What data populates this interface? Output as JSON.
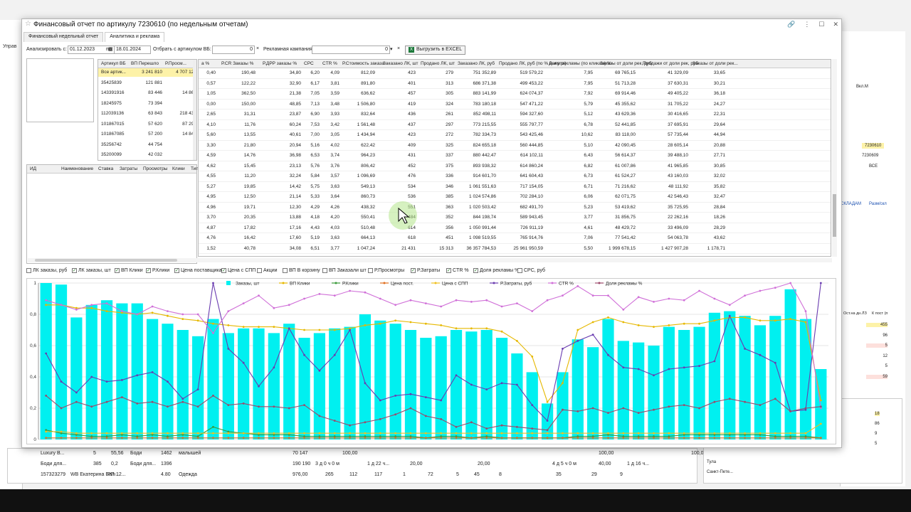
{
  "window": {
    "title": "Финансовый отчет по артикулу 7230610 (по недельным отчетам)",
    "tabs": [
      "Финансовый недельный отчет",
      "Аналитика и реклама"
    ],
    "active_tab": 1
  },
  "filters": {
    "analyze_from_label": "Анализировать с:",
    "date_from": "01.12.2023",
    "to_label": "по:",
    "date_to": "18.01.2024",
    "filter_label": "Отбрать с артикулом ВБ:",
    "filter_value": "0",
    "campaign_label": "Рекламная кампания:",
    "campaign_value": "0",
    "excel_label": "Выгрузить в EXCEL"
  },
  "background": {
    "left_label": "Управ",
    "bottom_rows": [
      [
        "Luxury B...",
        "5",
        "55,56",
        "Боди",
        "1462",
        "малышей",
        "70 147",
        "100,00",
        "100,00",
        "100,00"
      ],
      [
        "Боди для...",
        "385",
        "0,2",
        "Боди для...",
        "1396",
        "",
        "190 190",
        "3 д 0 ч 0 м",
        "1 д 22 ч...",
        "20,00",
        "20,00",
        "4 д 5 ч 0 м",
        "40,00",
        "1 д 16 ч..."
      ],
      [
        "157323279",
        "WB Екатерина Бал...",
        "РП-12...",
        "4.80",
        "Одежда",
        "976,00",
        "265",
        "112",
        "117",
        "1",
        "72",
        "5",
        "45",
        "8",
        "35",
        "29",
        "9"
      ]
    ],
    "right_items": [
      "7230610",
      "7230609",
      "ВСЕ",
      "Вкл.М",
      "СКЛАДАМ",
      "Разм/скл"
    ],
    "right_cols": [
      "Ост.на дн.ЛЗ",
      "К пост (п"
    ],
    "right_vals": [
      "455",
      "96",
      "5",
      "12",
      "5",
      "59",
      "18",
      "86",
      "9",
      "5"
    ],
    "right_city": [
      "Тула",
      "Санкт-Пете..."
    ]
  },
  "sku_table": {
    "headers": [
      "Артикул ВБ",
      "ВП Перешло",
      "Р.Просм..."
    ],
    "rows": [
      [
        "Все артик...",
        "3 241 810",
        "4 707 122"
      ],
      [
        "35425839",
        "121 881",
        ""
      ],
      [
        "143391916",
        "83 446",
        "14 862"
      ],
      [
        "18245975",
        "73 394",
        ""
      ],
      [
        "112039136",
        "63 843",
        "218 437"
      ],
      [
        "101867015",
        "57 620",
        "87 295"
      ],
      [
        "101867085",
        "57 200",
        "14 841"
      ],
      [
        "35256742",
        "44 754",
        ""
      ],
      [
        "35200099",
        "42 032",
        ""
      ]
    ]
  },
  "id_table": {
    "headers": [
      "ИД",
      "Наименование",
      "Ставка",
      "Затраты",
      "Просмотры",
      "Клики",
      "Тип"
    ]
  },
  "main_table": {
    "headers": [
      "а %",
      "Р.CR Заказы %",
      "Р.ДРР заказы %",
      "CPC",
      "CTR %",
      "Р.Стоимость заказа",
      "Заказано ЛК, шт",
      "Продано ЛК, шт",
      "Заказано ЛК, руб",
      "Продано ЛК, руб (по % выкупа)",
      "Доля рекламы (по кликам) %",
      "Заказы от доли рек, руб",
      "Продажи от доли рек, руб",
      "Заказы от доли рек..."
    ],
    "rows": [
      [
        "0,40",
        "190,48",
        "34,80",
        "6,20",
        "4,09",
        "812,09",
        "423",
        "279",
        "751 352,89",
        "519 579,22",
        "7,95",
        "69 765,15",
        "41 329,09",
        "33,65"
      ],
      [
        "0,57",
        "122,22",
        "32,90",
        "6,17",
        "3,81",
        "891,80",
        "401",
        "313",
        "686 371,38",
        "499 453,22",
        "7,95",
        "51 713,28",
        "37 630,31",
        "30,21"
      ],
      [
        "1,05",
        "362,50",
        "21,38",
        "7,05",
        "3,59",
        "636,62",
        "457",
        "305",
        "883 141,99",
        "624 074,37",
        "7,92",
        "69 914,46",
        "49 405,22",
        "36,18"
      ],
      [
        "0,00",
        "150,00",
        "48,85",
        "7,13",
        "3,48",
        "1 506,80",
        "419",
        "324",
        "783 180,18",
        "547 471,22",
        "5,79",
        "45 355,62",
        "31 705,22",
        "24,27"
      ],
      [
        "2,65",
        "31,31",
        "23,87",
        "6,90",
        "3,93",
        "832,64",
        "436",
        "261",
        "852 498,11",
        "594 327,60",
        "5,12",
        "43 629,36",
        "30 416,65",
        "22,31"
      ],
      [
        "4,10",
        "11,76",
        "60,24",
        "7,53",
        "3,42",
        "1 561,48",
        "437",
        "297",
        "773 215,55",
        "555 797,77",
        "6,78",
        "52 441,85",
        "37 695,91",
        "29,64"
      ],
      [
        "5,60",
        "13,55",
        "40,61",
        "7,00",
        "3,05",
        "1 434,94",
        "423",
        "272",
        "782 334,73",
        "543 425,46",
        "10,62",
        "83 118,00",
        "57 735,44",
        "44,94"
      ],
      [
        "3,30",
        "21,80",
        "20,94",
        "5,16",
        "4,02",
        "622,42",
        "409",
        "325",
        "824 655,18",
        "560 444,85",
        "5,10",
        "42 090,45",
        "28 605,14",
        "20,88"
      ],
      [
        "4,59",
        "14,76",
        "36,98",
        "6,53",
        "3,74",
        "964,23",
        "431",
        "337",
        "880 442,47",
        "614 102,11",
        "6,43",
        "56 614,37",
        "39 488,10",
        "27,71"
      ],
      [
        "4,62",
        "15,45",
        "23,13",
        "5,76",
        "3,76",
        "806,42",
        "452",
        "375",
        "893 938,32",
        "614 860,24",
        "6,82",
        "61 007,86",
        "41 965,85",
        "30,85"
      ],
      [
        "4,55",
        "11,20",
        "32,24",
        "5,84",
        "3,57",
        "1 096,69",
        "476",
        "336",
        "914 601,70",
        "641 604,43",
        "6,73",
        "61 524,27",
        "43 160,03",
        "32,02"
      ],
      [
        "5,27",
        "19,85",
        "14,42",
        "5,75",
        "3,63",
        "549,13",
        "534",
        "346",
        "1 061 551,63",
        "717 154,05",
        "6,71",
        "71 216,62",
        "48 111,92",
        "35,82"
      ],
      [
        "4,95",
        "12,50",
        "21,14",
        "5,33",
        "3,64",
        "860,73",
        "536",
        "385",
        "1 024 574,86",
        "702 284,10",
        "6,06",
        "62 071,75",
        "42 546,43",
        "32,47"
      ],
      [
        "4,96",
        "19,71",
        "12,30",
        "4,29",
        "4,26",
        "438,32",
        "551",
        "363",
        "1 020 503,42",
        "682 491,70",
        "5,23",
        "53 419,62",
        "35 725,95",
        "28,84"
      ],
      [
        "3,70",
        "20,35",
        "13,88",
        "4,18",
        "4,20",
        "550,41",
        "484",
        "352",
        "844 198,74",
        "589 943,45",
        "3,77",
        "31 856,75",
        "22 262,16",
        "18,26"
      ],
      [
        "4,87",
        "17,82",
        "17,16",
        "4,43",
        "4,03",
        "510,48",
        "614",
        "356",
        "1 050 991,44",
        "726 911,19",
        "4,61",
        "48 429,72",
        "33 496,09",
        "28,29"
      ],
      [
        "4,76",
        "16,42",
        "17,60",
        "5,19",
        "3,63",
        "664,13",
        "618",
        "451",
        "1 098 519,55",
        "765 914,76",
        "7,06",
        "77 541,42",
        "54 063,78",
        "43,62"
      ],
      [
        "1,52",
        "40,78",
        "34,08",
        "6,51",
        "3,77",
        "1 047,24",
        "21 431",
        "15 313",
        "36 357 784,53",
        "25 961 950,59",
        "5,50",
        "1 999 678,15",
        "1 427 907,28",
        "1 178,71"
      ]
    ]
  },
  "checkboxes": [
    {
      "label": "ЛК заказы, руб",
      "checked": false
    },
    {
      "label": "ЛК заказы, шт",
      "checked": true
    },
    {
      "label": "ВП Клики",
      "checked": true
    },
    {
      "label": "Р.Клики",
      "checked": true
    },
    {
      "label": "Цена поставщика",
      "checked": true
    },
    {
      "label": "Цена с СПП",
      "checked": true
    },
    {
      "label": "Акции",
      "checked": false
    },
    {
      "label": "ВП В корзину",
      "checked": false
    },
    {
      "label": "ВП Заказали шт",
      "checked": false
    },
    {
      "label": "Р.Просмотры",
      "checked": false
    },
    {
      "label": "Р.Затраты",
      "checked": true
    },
    {
      "label": "CTR %",
      "checked": true
    },
    {
      "label": "Доля рекламы %",
      "checked": true
    },
    {
      "label": "CPC, руб",
      "checked": false
    }
  ],
  "chart_data": {
    "type": "bar",
    "ylim": [
      0,
      1
    ],
    "yticks": [
      "0",
      "0,2",
      "0,4",
      "0,6",
      "0,8",
      "1"
    ],
    "grid": true,
    "legend_position": "top",
    "bar_series": {
      "name": "Заказы, шт",
      "color": "#00f0f0",
      "values": [
        1.0,
        0.99,
        0.78,
        0.86,
        0.89,
        0.87,
        0.87,
        0.77,
        0.74,
        0.7,
        0.66,
        0.77,
        0.68,
        0.71,
        0.71,
        0.68,
        0.74,
        0.65,
        0.68,
        0.71,
        0.72,
        0.8,
        0.76,
        0.74,
        0.7,
        0.65,
        0.66,
        0.7,
        0.69,
        0.7,
        0.65,
        0.55,
        0.43,
        0.23,
        0.43,
        0.64,
        0.59,
        0.77,
        0.63,
        0.62,
        0.6,
        0.72,
        0.7,
        0.72,
        0.81,
        0.82,
        0.79,
        0.73,
        0.79,
        0.96,
        0.77,
        0.45
      ]
    },
    "line_series": [
      {
        "name": "ВП Клики",
        "color": "#e6b800",
        "values": [
          0.86,
          0.86,
          0.84,
          0.84,
          0.82,
          0.81,
          0.8,
          0.81,
          0.79,
          0.77,
          0.76,
          0.74,
          0.73,
          0.72,
          0.72,
          0.72,
          0.71,
          0.7,
          0.7,
          0.7,
          0.71,
          0.73,
          0.74,
          0.76,
          0.75,
          0.74,
          0.73,
          0.71,
          0.71,
          0.71,
          0.69,
          0.63,
          0.53,
          0.24,
          0.36,
          0.7,
          0.75,
          0.78,
          0.75,
          0.73,
          0.72,
          0.73,
          0.74,
          0.74,
          0.76,
          0.78,
          0.78,
          0.76,
          0.76,
          0.77,
          0.75,
          0.25
        ]
      },
      {
        "name": "Р.Клики",
        "color": "#3a9a3a",
        "values": [
          0.06,
          0.04,
          0.03,
          0.02,
          0.02,
          0.03,
          0.02,
          0.03,
          0.02,
          0.03,
          0.02,
          0.08,
          0.05,
          0.04,
          0.03,
          0.03,
          0.03,
          0.02,
          0.02,
          0.02,
          0.02,
          0.02,
          0.02,
          0.02,
          0.02,
          0.01,
          0.02,
          0.02,
          0.01,
          0.02,
          0.01,
          0.01,
          0.01,
          0.01,
          0.01,
          0.02,
          0.02,
          0.03,
          0.02,
          0.02,
          0.02,
          0.02,
          0.03,
          0.03,
          0.03,
          0.03,
          0.03,
          0.03,
          0.02,
          0.02,
          0.02,
          0.01
        ]
      },
      {
        "name": "Цена пост.",
        "color": "#e07020",
        "values": [
          0.01,
          0.01,
          0.01,
          0.01,
          0.01,
          0.01,
          0.01,
          0.01,
          0.01,
          0.01,
          0.01,
          0.01,
          0.01,
          0.01,
          0.01,
          0.01,
          0.01,
          0.01,
          0.01,
          0.01,
          0.01,
          0.01,
          0.01,
          0.01,
          0.01,
          0.01,
          0.01,
          0.01,
          0.01,
          0.01,
          0.01,
          0.01,
          0.01,
          0.01,
          0.01,
          0.01,
          0.01,
          0.01,
          0.01,
          0.01,
          0.01,
          0.01,
          0.01,
          0.01,
          0.01,
          0.01,
          0.01,
          0.01,
          0.01,
          0.01,
          0.01,
          0.01
        ]
      },
      {
        "name": "Цена с СПП",
        "color": "#f0c020",
        "values": [
          0.05,
          0.05,
          0.04,
          0.04,
          0.04,
          0.04,
          0.04,
          0.04,
          0.04,
          0.04,
          0.04,
          0.04,
          0.04,
          0.04,
          0.04,
          0.04,
          0.04,
          0.04,
          0.04,
          0.04,
          0.04,
          0.04,
          0.04,
          0.04,
          0.04,
          0.04,
          0.04,
          0.04,
          0.04,
          0.04,
          0.04,
          0.04,
          0.04,
          0.04,
          0.04,
          0.04,
          0.04,
          0.04,
          0.04,
          0.04,
          0.04,
          0.04,
          0.04,
          0.04,
          0.04,
          0.04,
          0.04,
          0.04,
          0.04,
          0.04,
          0.04,
          0.1
        ]
      },
      {
        "name": "Р.Затраты, руб",
        "color": "#6a3cb0",
        "values": [
          0.55,
          0.37,
          0.3,
          0.4,
          0.37,
          0.38,
          0.41,
          0.43,
          0.37,
          0.26,
          0.32,
          1.0,
          0.58,
          0.49,
          0.34,
          0.46,
          0.71,
          0.54,
          0.44,
          0.54,
          0.7,
          0.36,
          0.25,
          0.28,
          0.29,
          0.27,
          0.25,
          0.41,
          0.35,
          0.32,
          0.36,
          0.35,
          0.22,
          0.12,
          0.58,
          0.63,
          0.67,
          0.54,
          0.46,
          0.45,
          0.41,
          0.45,
          0.46,
          0.47,
          0.5,
          0.79,
          0.58,
          0.54,
          0.49,
          0.18,
          0.19,
          1.0
        ]
      },
      {
        "name": "CTR %",
        "color": "#d070d8",
        "values": [
          0.89,
          0.86,
          0.83,
          0.86,
          0.87,
          0.82,
          0.8,
          0.85,
          0.82,
          0.8,
          0.8,
          0.68,
          0.82,
          0.87,
          0.92,
          0.84,
          0.86,
          0.9,
          0.93,
          0.92,
          0.95,
          0.94,
          0.9,
          0.86,
          0.89,
          0.87,
          0.85,
          0.89,
          0.88,
          0.89,
          0.85,
          0.87,
          0.82,
          0.89,
          0.92,
          0.98,
          0.92,
          0.92,
          0.83,
          0.91,
          0.88,
          0.9,
          0.89,
          0.95,
          0.9,
          0.86,
          0.92,
          0.95,
          0.97,
          1.0,
          0.82,
          0.2
        ]
      },
      {
        "name": "Доля рекламы %",
        "color": "#9c4a6c",
        "values": [
          0.28,
          0.2,
          0.24,
          0.21,
          0.24,
          0.27,
          0.23,
          0.24,
          0.21,
          0.24,
          0.21,
          0.28,
          0.22,
          0.23,
          0.21,
          0.21,
          0.2,
          0.22,
          0.15,
          0.12,
          0.09,
          0.11,
          0.13,
          0.16,
          0.2,
          0.15,
          0.13,
          0.08,
          0.11,
          0.07,
          0.09,
          0.08,
          0.07,
          0.06,
          0.19,
          0.18,
          0.2,
          0.17,
          0.2,
          0.17,
          0.19,
          0.21,
          0.22,
          0.2,
          0.24,
          0.26,
          0.24,
          0.22,
          0.26,
          0.18,
          0.2,
          0.21
        ]
      }
    ],
    "legend": [
      "Заказы, шт",
      "ВП Клики",
      "Р.Клики",
      "Цена пост.",
      "Цена с СПП",
      "Р.Затраты, руб",
      "CTR %",
      "Доля рекламы %"
    ]
  }
}
